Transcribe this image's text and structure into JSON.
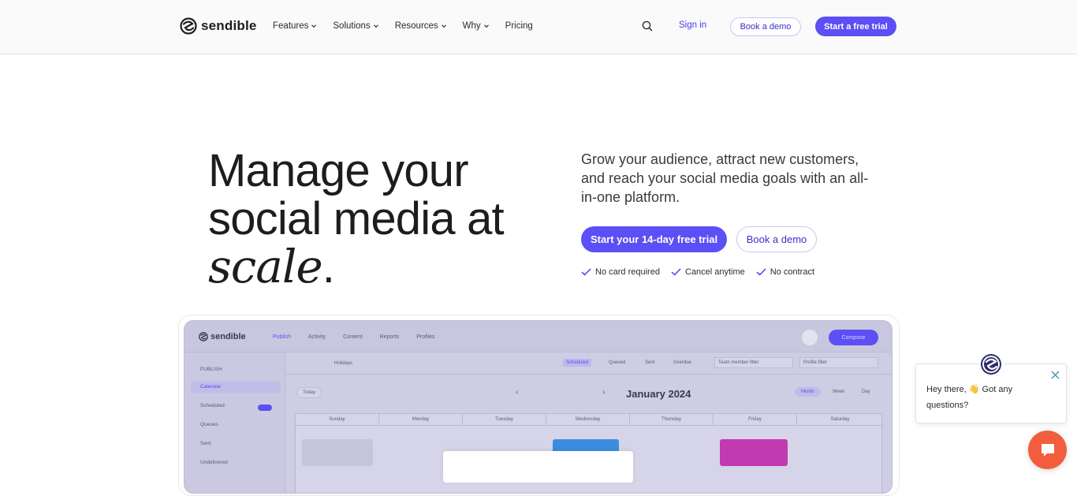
{
  "brand": {
    "name": "sendible",
    "accent": "#5b4ff5"
  },
  "nav": {
    "menu": [
      {
        "label": "Features",
        "has_dropdown": true
      },
      {
        "label": "Solutions",
        "has_dropdown": true
      },
      {
        "label": "Resources",
        "has_dropdown": true
      },
      {
        "label": "Why",
        "has_dropdown": true
      },
      {
        "label": "Pricing",
        "has_dropdown": false
      }
    ],
    "search_icon": "search-icon",
    "sign_in": "Sign in",
    "book_demo": "Book a demo",
    "start_trial": "Start a free trial"
  },
  "hero": {
    "title_line1": "Manage your",
    "title_line2": "social media at",
    "title_italic": "scale",
    "title_end": ".",
    "subtitle": "Grow your audience, attract new customers, and reach your social media goals with an all-in-one platform.",
    "cta_primary": "Start your 14-day free trial",
    "cta_secondary": "Book a demo",
    "perks": [
      "No card required",
      "Cancel anytime",
      "No contract"
    ]
  },
  "preview": {
    "logo": "sendible",
    "tabs": [
      "Publish",
      "Activity",
      "Content",
      "Reports",
      "Profiles"
    ],
    "active_tab": "Publish",
    "compose": "Compose",
    "sidebar": [
      "PUBLISH",
      "Calendar",
      "Scheduled",
      "Queues",
      "Sent",
      "Undelivered"
    ],
    "toolbar_holidays": "Holidays",
    "filters": [
      "Scheduled",
      "Queued",
      "Sent",
      "Overdue"
    ],
    "search_team": "Team member filter",
    "search_profile": "Profile filter",
    "today": "Today",
    "month": "January 2024",
    "views": [
      "Month",
      "Week",
      "Day"
    ],
    "days": [
      "Sunday",
      "Monday",
      "Tuesday",
      "Wednesday",
      "Thursday",
      "Friday",
      "Saturday"
    ]
  },
  "chat": {
    "greeting": "Hey there, 👋 Got any questions?",
    "launcher_color": "#f25d3e"
  }
}
